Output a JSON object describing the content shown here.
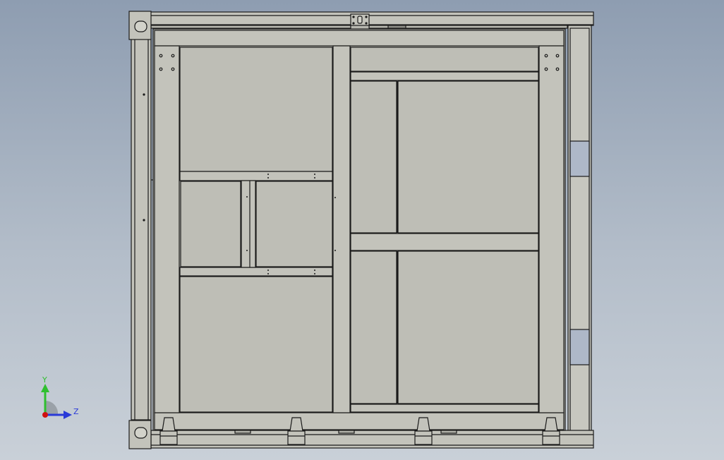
{
  "viewport": {
    "colors": {
      "panel": "#bebeb6",
      "frame": "#c3c3bb",
      "line": "#1a1a1a",
      "slot": "#aeb8c8"
    }
  },
  "triad": {
    "y_label": "Y",
    "z_label": "Z",
    "colors": {
      "y": "#2fbf2f",
      "z": "#2a3ad8",
      "origin": "#d01010"
    }
  }
}
